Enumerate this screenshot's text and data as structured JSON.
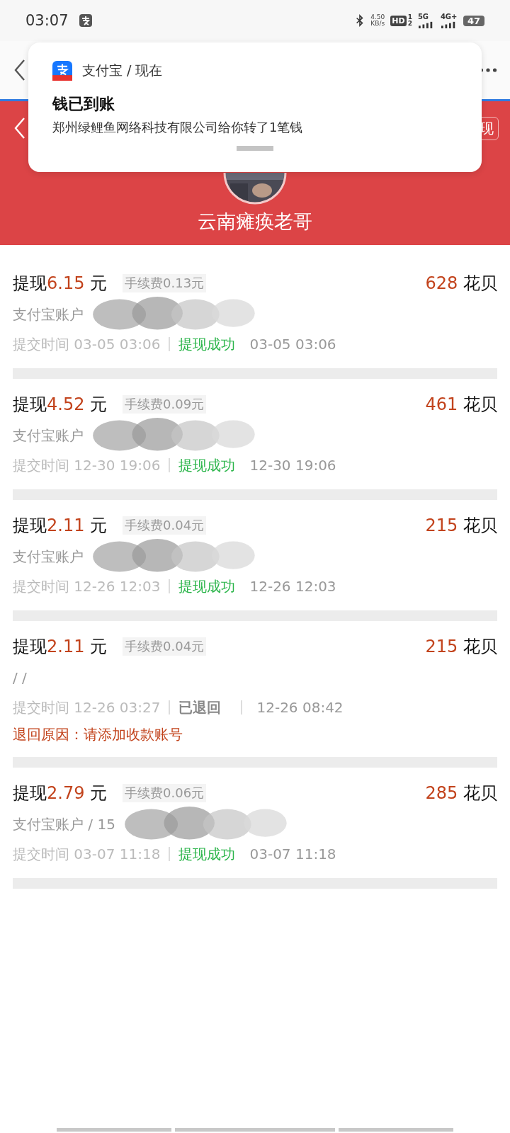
{
  "status_bar": {
    "time": "03:07",
    "speed": "4.50",
    "speed_unit": "KB/s",
    "hd": "HD",
    "hd_slots": [
      "1",
      "2"
    ],
    "network_1": "5G",
    "network_2": "4G+",
    "battery": "47"
  },
  "banner": {
    "button_label": "现",
    "name": "云南瘫痪老哥"
  },
  "notification": {
    "app": "支付宝 / 现在",
    "title": "钱已到账",
    "body": "郑州绿鲤鱼网络科技有限公司给你转了1笔钱"
  },
  "records": [
    {
      "label": "提现",
      "amount": "6.15",
      "unit": "元",
      "fee": "手续费0.13元",
      "points": "628",
      "points_unit": "花贝",
      "account": "支付宝账户",
      "submit_label": "提交时间",
      "submit_time": "03-05 03:06",
      "status": "提现成功",
      "kind": "success",
      "result_time": "03-05 03:06",
      "redacted": true
    },
    {
      "label": "提现",
      "amount": "4.52",
      "unit": "元",
      "fee": "手续费0.09元",
      "points": "461",
      "points_unit": "花贝",
      "account": "支付宝账户",
      "submit_label": "提交时间",
      "submit_time": "12-30 19:06",
      "status": "提现成功",
      "kind": "success",
      "result_time": "12-30 19:06",
      "redacted": true
    },
    {
      "label": "提现",
      "amount": "2.11",
      "unit": "元",
      "fee": "手续费0.04元",
      "points": "215",
      "points_unit": "花贝",
      "account": "支付宝账户",
      "submit_label": "提交时间",
      "submit_time": "12-26 12:03",
      "status": "提现成功",
      "kind": "success",
      "result_time": "12-26 12:03",
      "redacted": true
    },
    {
      "label": "提现",
      "amount": "2.11",
      "unit": "元",
      "fee": "手续费0.04元",
      "points": "215",
      "points_unit": "花贝",
      "account": "/ /",
      "submit_label": "提交时间",
      "submit_time": "12-26 03:27",
      "status": "已退回",
      "kind": "returned",
      "result_time": "12-26 08:42",
      "reason_label": "退回原因：",
      "reason": "请添加收款账号",
      "redacted": false
    },
    {
      "label": "提现",
      "amount": "2.79",
      "unit": "元",
      "fee": "手续费0.06元",
      "points": "285",
      "points_unit": "花贝",
      "account": "支付宝账户 / 15",
      "submit_label": "提交时间",
      "submit_time": "03-07 11:18",
      "status": "提现成功",
      "kind": "success",
      "result_time": "03-07 11:18",
      "redacted": true
    }
  ]
}
